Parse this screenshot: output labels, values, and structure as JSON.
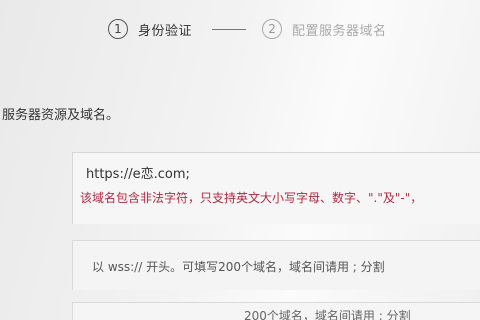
{
  "stepper": {
    "step1": {
      "number": "1",
      "label": "身份验证"
    },
    "step2": {
      "number": "2",
      "label": "配置服务器域名"
    }
  },
  "intro_text": "服务器资源及域名。",
  "domain_input": {
    "value": "https://e恋.com;",
    "error": "该域名包含非法字符，只支持英文大小写字母、数字、\".\"及\"-\"，"
  },
  "ws_input": {
    "placeholder": "以 wss:// 开头。可填写200个域名，域名间请用 ; 分割"
  },
  "next_input": {
    "placeholder": "200个域名，域名间请用 ; 分割"
  }
}
